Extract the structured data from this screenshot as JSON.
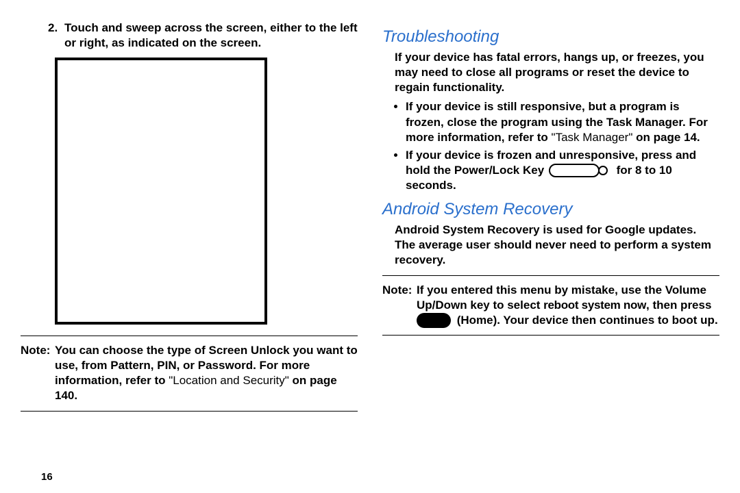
{
  "left": {
    "step_num": "2.",
    "step_text": "Touch and sweep across the screen, either to the left or right, as indicated on the screen.",
    "note_label": "Note:",
    "note_text_bold1": "You can choose the type of Screen Unlock you want to use, from Pattern, PIN, or Password. For more information, refer to ",
    "note_text_light": "\"Location and Security\" ",
    "note_text_bold2": "on page 140.",
    "page_num": "16"
  },
  "right": {
    "h_trouble": "Troubleshooting",
    "trouble_para": "If your device has fatal errors, hangs up, or freezes, you may need to close all programs or reset the device to regain functionality.",
    "bullet1_bold": "If your device is still responsive, but a program is frozen, close the program using the Task Manager. For more information, refer to ",
    "bullet1_light": "\"Task Manager\" ",
    "bullet1_bold2": "on page 14.",
    "bullet2_a": "If your device is frozen and unresponsive, press and hold the Power/Lock Key ",
    "bullet2_b": " for 8 to 10 seconds.",
    "h_android": "Android System Recovery",
    "android_para": "Android System Recovery is used for Google updates. The average user should never need to perform a system recovery.",
    "note_label": "Note:",
    "note_text1": "If you entered this menu by mistake, use the Volume Up/Down key to select ",
    "note_reboot": "reboot system now",
    "note_text2": ", then press ",
    "note_text3": " (Home). Your device then continues to boot up."
  }
}
